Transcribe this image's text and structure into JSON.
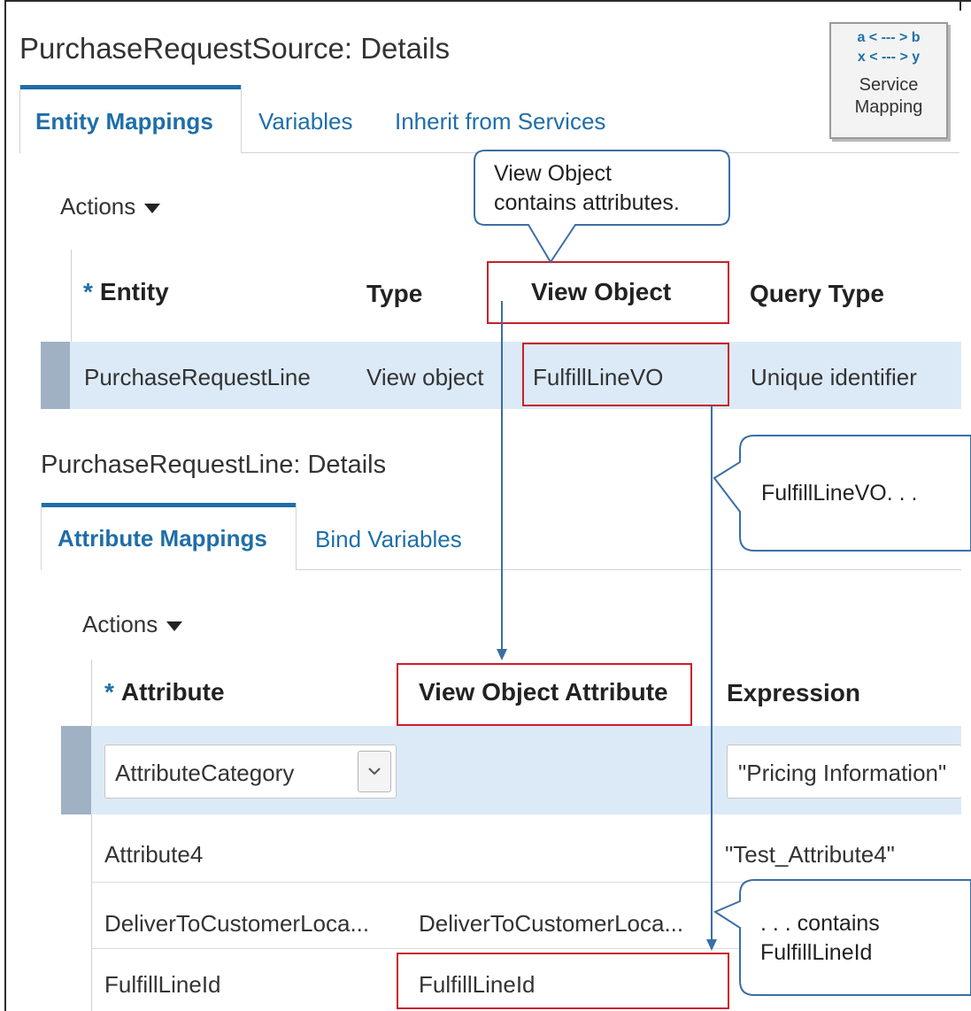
{
  "header": {
    "title": "PurchaseRequestSource: Details"
  },
  "service_mapping_button": {
    "mapping_line1": "a < --- > b",
    "mapping_line2": "x < --- > y",
    "label_line1": "Service",
    "label_line2": "Mapping"
  },
  "top_tabs": [
    {
      "label": "Entity Mappings",
      "active": true
    },
    {
      "label": "Variables",
      "active": false
    },
    {
      "label": "Inherit from Services",
      "active": false
    }
  ],
  "entity_section": {
    "actions_label": "Actions",
    "columns": {
      "required_mark": "*",
      "entity": "Entity",
      "type": "Type",
      "view_object": "View Object",
      "query_type": "Query Type"
    },
    "rows": [
      {
        "entity": "PurchaseRequestLine",
        "type": "View object",
        "view_object": "FulfillLineVO",
        "query_type": "Unique identifier",
        "selected": true
      }
    ]
  },
  "details_section": {
    "title": "PurchaseRequestLine: Details",
    "tabs": [
      {
        "label": "Attribute Mappings",
        "active": true
      },
      {
        "label": "Bind Variables",
        "active": false
      }
    ],
    "actions_label": "Actions",
    "columns": {
      "required_mark": "*",
      "attribute": "Attribute",
      "view_object_attribute": "View Object Attribute",
      "expression": "Expression"
    },
    "rows": [
      {
        "attribute": "AttributeCategory",
        "view_object_attribute": "",
        "expression": "\"Pricing Information\"",
        "selected": true,
        "editable": true
      },
      {
        "attribute": "Attribute4",
        "view_object_attribute": "",
        "expression": "\"Test_Attribute4\""
      },
      {
        "attribute": "DeliverToCustomerLoca...",
        "view_object_attribute": "DeliverToCustomerLoca...",
        "expression": ""
      },
      {
        "attribute": "FulfillLineId",
        "view_object_attribute": "FulfillLineId",
        "expression": ""
      }
    ]
  },
  "callouts": {
    "view_object": {
      "line1": "View Object",
      "line2": "contains attributes."
    },
    "fulfill_vo": {
      "line1": "FulfillLineVO. . ."
    },
    "contains": {
      "line1": ". . . contains",
      "line2": "FulfillLineId"
    }
  },
  "colors": {
    "accent_blue": "#1f6ea8",
    "highlight_red": "#c8202b",
    "selected_row": "#dbeaf6",
    "arrow": "#3b6ea5"
  },
  "icons": {
    "actions_menu": "caret-down-icon",
    "attribute_dropdown": "chevron-down-icon"
  }
}
